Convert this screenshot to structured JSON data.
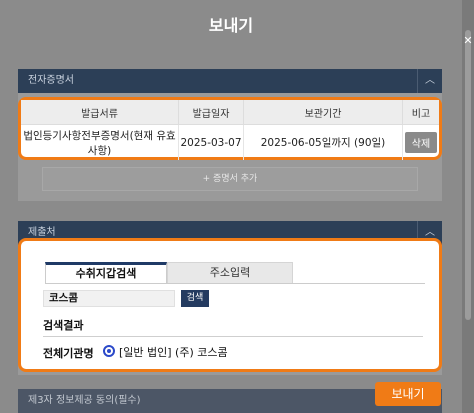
{
  "title": "보내기",
  "sections": {
    "certificate": {
      "header": "전자증명서",
      "columns": [
        "발급서류",
        "발급일자",
        "보관기간",
        "비고"
      ],
      "rows": [
        {
          "doc": "법인등기사항전부증명서(현재 유효사항)",
          "date": "2025-03-07",
          "period": "2025-06-05일까지 (90일)",
          "action": "삭제"
        }
      ],
      "add_label": "+ 증명서 추가"
    },
    "recipient": {
      "header": "제출처",
      "tabs": [
        "수취지갑검색",
        "주소입력"
      ],
      "search_value": "코스콤",
      "search_button": "검색",
      "result_label": "검색결과",
      "org_label": "전체기관명",
      "org_value": "[일반 법인] (주) 코스콤"
    },
    "third_party": {
      "header": "제3자 정보제공 동의(필수)"
    }
  },
  "send_button": "보내기",
  "colors": {
    "accent": "#f07b16",
    "navy": "#2c3f57",
    "link": "#2b49c9"
  }
}
